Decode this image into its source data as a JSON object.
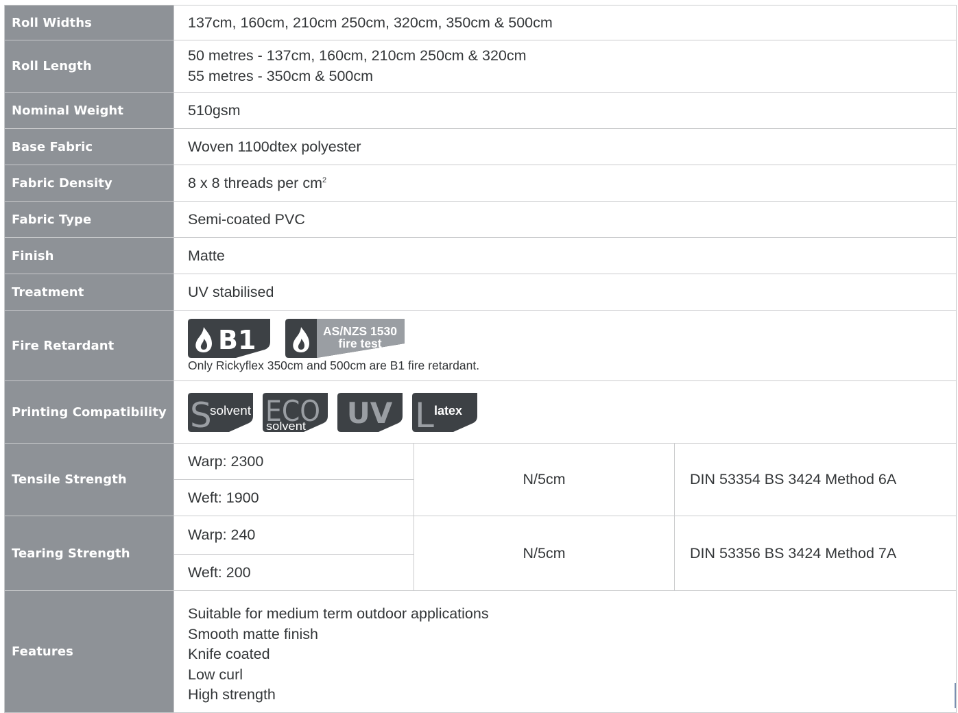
{
  "rows": {
    "roll_widths": {
      "label": "Roll Widths",
      "value": "137cm, 160cm, 210cm 250cm, 320cm, 350cm & 500cm"
    },
    "roll_length": {
      "label": "Roll Length",
      "lines": [
        "50 metres - 137cm, 160cm, 210cm 250cm & 320cm",
        "55 metres - 350cm & 500cm"
      ]
    },
    "nominal_weight": {
      "label": "Nominal Weight",
      "value": "510gsm"
    },
    "base_fabric": {
      "label": "Base Fabric",
      "value": "Woven 1100dtex polyester"
    },
    "fabric_density": {
      "label": "Fabric Density",
      "value": "8 x 8 threads per cm",
      "sup": "2"
    },
    "fabric_type": {
      "label": "Fabric Type",
      "value": "Semi-coated PVC"
    },
    "finish": {
      "label": "Finish",
      "value": "Matte"
    },
    "treatment": {
      "label": "Treatment",
      "value": "UV stabilised"
    },
    "fire_retardant": {
      "label": "Fire Retardant",
      "badges": {
        "b1": "B1",
        "asnzs_line1": "AS/NZS 1530",
        "asnzs_line2": "fire test"
      },
      "note": "Only Rickyflex 350cm and 500cm are B1 fire retardant."
    },
    "printing_compatibility": {
      "label": "Printing Compatibility",
      "badges": {
        "solvent_letter": "S",
        "solvent_text": "solvent",
        "eco_top": "ECO",
        "eco_bottom": "solvent",
        "uv": "UV",
        "latex_letter": "L",
        "latex_text": "latex"
      }
    },
    "tensile_strength": {
      "label": "Tensile Strength",
      "warp": "Warp: 2300",
      "weft": "Weft: 1900",
      "unit": "N/5cm",
      "standard": "DIN 53354 BS 3424 Method 6A"
    },
    "tearing_strength": {
      "label": "Tearing Strength",
      "warp": "Warp: 240",
      "weft": "Weft: 200",
      "unit": "N/5cm",
      "standard": "DIN 53356 BS 3424 Method 7A"
    },
    "features": {
      "label": "Features",
      "items": [
        "Suitable for medium term outdoor applications",
        "Smooth matte finish",
        "Knife coated",
        "Low curl",
        "High strength"
      ]
    }
  },
  "colors": {
    "label_bg": "#8e9297",
    "badge_dark": "#3d4145",
    "badge_grey": "#9a9ea3",
    "text": "#333638",
    "border": "#c9cacc"
  },
  "icons": [
    "flame-icon"
  ]
}
